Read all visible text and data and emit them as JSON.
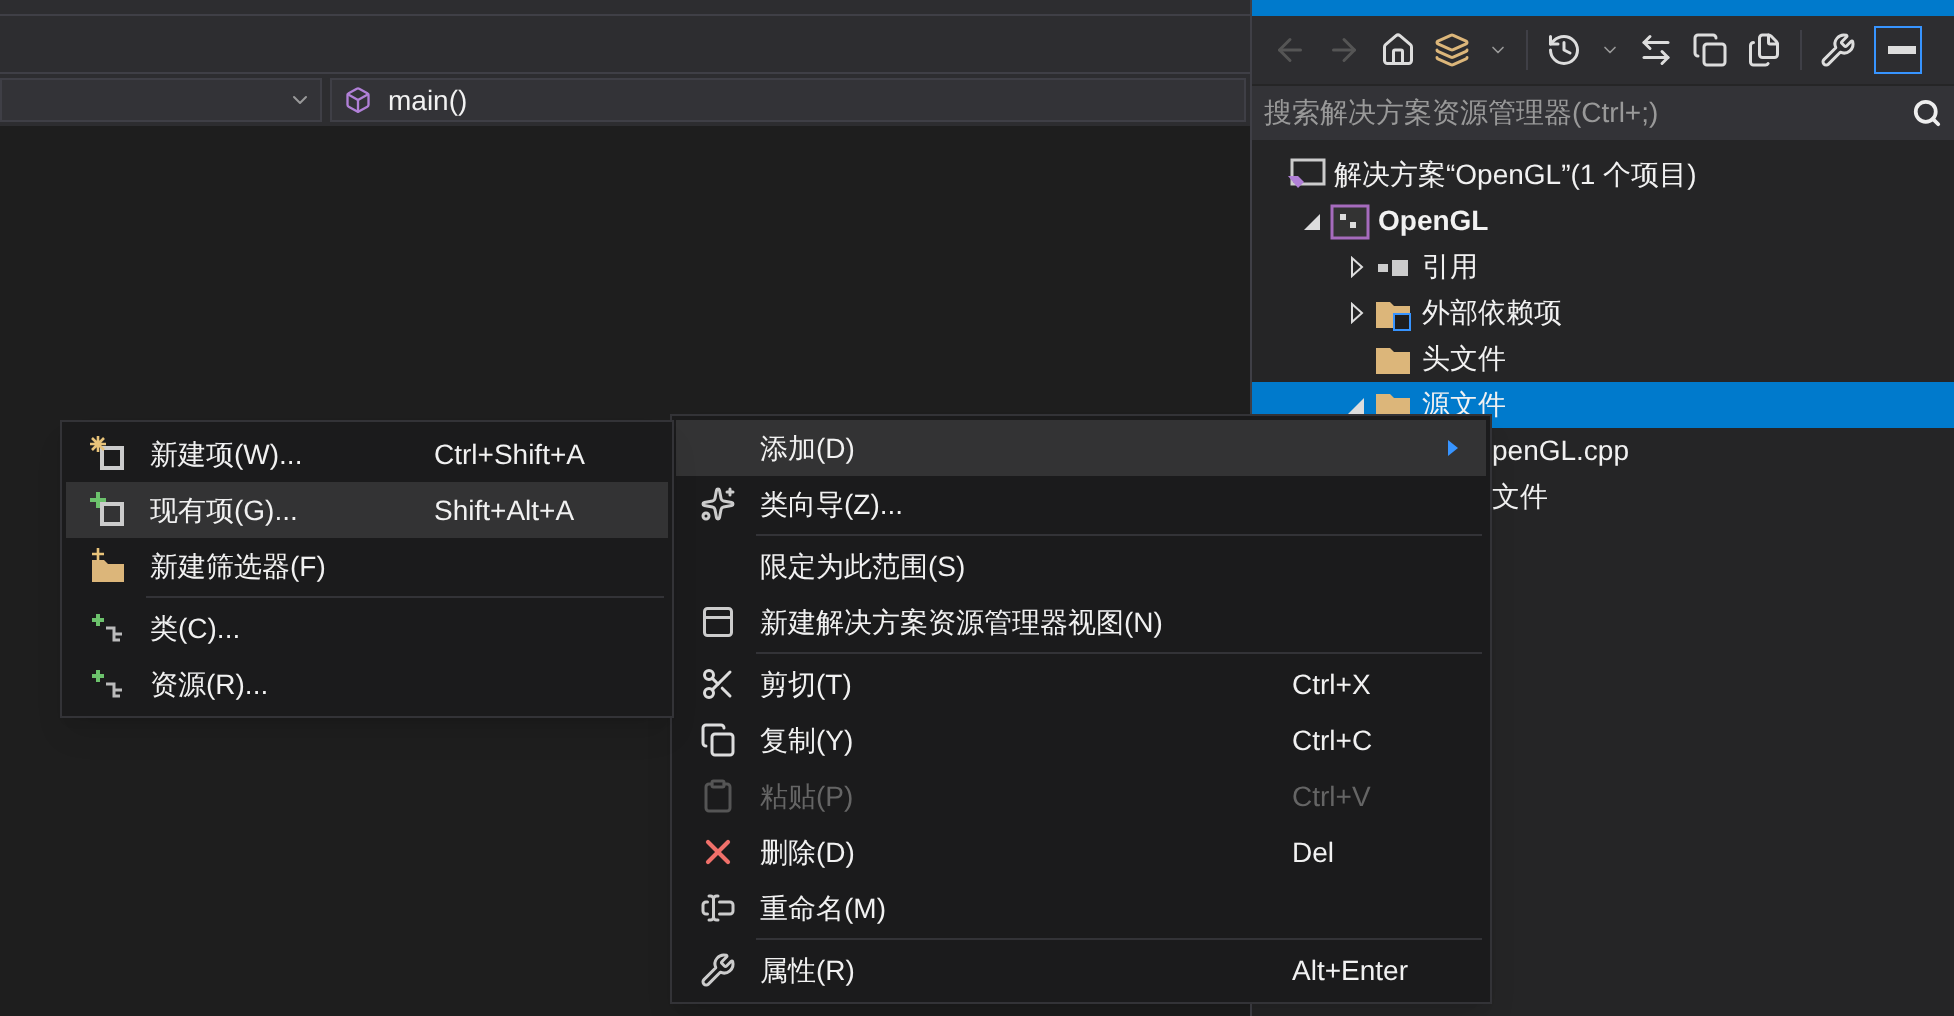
{
  "editor": {
    "navigation": {
      "member_dropdown": "main()"
    }
  },
  "solution_explorer": {
    "search": {
      "placeholder": "搜索解决方案资源管理器(Ctrl+;)"
    },
    "tree": [
      {
        "label": "解决方案“OpenGL”(1 个项目)",
        "kind": "solution",
        "selected": false,
        "children": [
          {
            "label": "OpenGL",
            "kind": "project",
            "expanded": true,
            "selected": false,
            "children": [
              {
                "label": "引用",
                "kind": "references",
                "expanded": false,
                "selected": false
              },
              {
                "label": "外部依赖项",
                "kind": "external",
                "expanded": false,
                "selected": false
              },
              {
                "label": "头文件",
                "kind": "filter",
                "selected": false
              },
              {
                "label": "源文件",
                "kind": "filter",
                "expanded": true,
                "selected": true,
                "children": [
                  {
                    "label": "penGL.cpp",
                    "kind": "partial",
                    "selected": false
                  }
                ]
              },
              {
                "label": "文件",
                "kind": "partial",
                "selected": false
              }
            ]
          }
        ]
      }
    ]
  },
  "context_menu": {
    "items": [
      {
        "kind": "item",
        "label": "添加(D)",
        "submenu": true,
        "selected": true,
        "disabled": false
      },
      {
        "kind": "item",
        "label": "类向导(Z)...",
        "selected": false,
        "disabled": false
      },
      {
        "kind": "separator"
      },
      {
        "kind": "item",
        "label": "限定为此范围(S)",
        "selected": false,
        "disabled": false
      },
      {
        "kind": "item",
        "label": "新建解决方案资源管理器视图(N)",
        "selected": false,
        "disabled": false
      },
      {
        "kind": "separator"
      },
      {
        "kind": "item",
        "label": "剪切(T)",
        "shortcut": "Ctrl+X",
        "selected": false,
        "disabled": false
      },
      {
        "kind": "item",
        "label": "复制(Y)",
        "shortcut": "Ctrl+C",
        "selected": false,
        "disabled": false
      },
      {
        "kind": "item",
        "label": "粘贴(P)",
        "shortcut": "Ctrl+V",
        "selected": false,
        "disabled": true
      },
      {
        "kind": "item",
        "label": "删除(D)",
        "shortcut": "Del",
        "selected": false,
        "disabled": false
      },
      {
        "kind": "item",
        "label": "重命名(M)",
        "selected": false,
        "disabled": false
      },
      {
        "kind": "separator"
      },
      {
        "kind": "item",
        "label": "属性(R)",
        "shortcut": "Alt+Enter",
        "selected": false,
        "disabled": false
      }
    ]
  },
  "submenu": {
    "items": [
      {
        "kind": "item",
        "label": "新建项(W)...",
        "shortcut": "Ctrl+Shift+A",
        "selected": false
      },
      {
        "kind": "item",
        "label": "现有项(G)...",
        "shortcut": "Shift+Alt+A",
        "selected": true
      },
      {
        "kind": "item",
        "label": "新建筛选器(F)",
        "selected": false
      },
      {
        "kind": "separator"
      },
      {
        "kind": "item",
        "label": "类(C)...",
        "selected": false
      },
      {
        "kind": "item",
        "label": "资源(R)...",
        "selected": false
      }
    ]
  }
}
